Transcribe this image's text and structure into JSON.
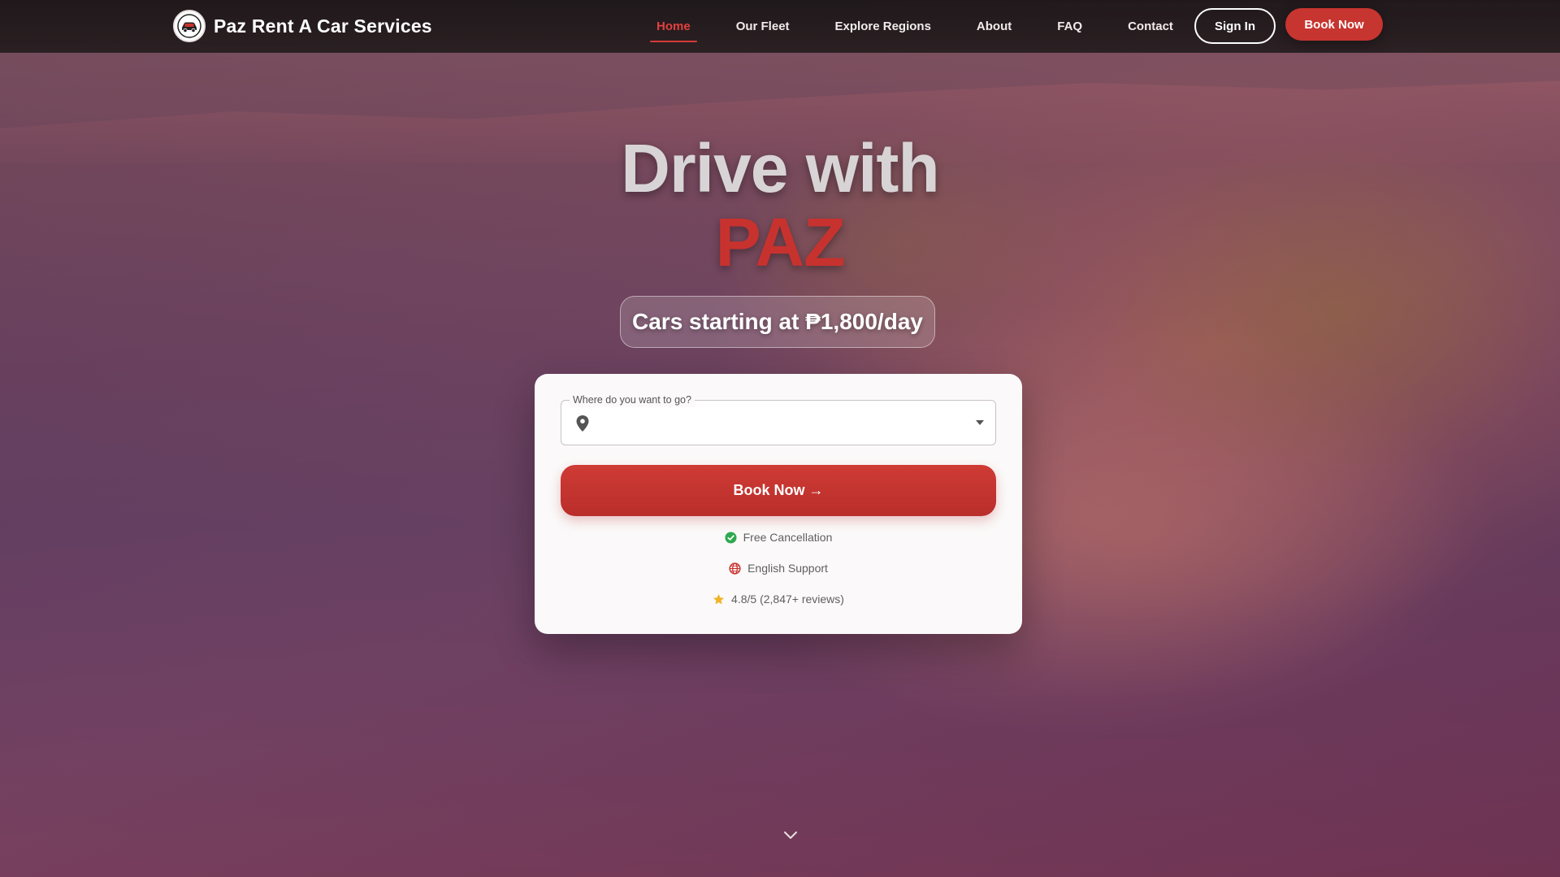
{
  "brand": {
    "name": "Paz Rent A Car Services",
    "logo_icon": "car-logo-icon"
  },
  "nav": {
    "items": [
      {
        "label": "Home",
        "active": true
      },
      {
        "label": "Our Fleet",
        "active": false
      },
      {
        "label": "Explore Regions",
        "active": false
      },
      {
        "label": "About",
        "active": false
      },
      {
        "label": "FAQ",
        "active": false
      },
      {
        "label": "Contact",
        "active": false
      }
    ],
    "sign_in_label": "Sign In",
    "book_now_label": "Book Now"
  },
  "hero": {
    "headline": "Drive with",
    "headline_brand": "PAZ",
    "price_text": "Cars starting at ₱1,800/day"
  },
  "booking": {
    "destination_label": "Where do you want to go?",
    "destination_value": "",
    "destination_icon": "map-pin-icon",
    "book_button_label": "Book Now →",
    "features": [
      {
        "icon": "check-circle-icon",
        "text": "Free Cancellation"
      },
      {
        "icon": "globe-icon",
        "text": "English Support"
      },
      {
        "icon": "star-icon",
        "text": "4.8/5 (2,847+ reviews)"
      }
    ]
  },
  "colors": {
    "accent": "#c8322e",
    "accent_active_nav": "#e0413d",
    "navbar_bg": "#1c1618",
    "card_bg": "#fbf9f9",
    "check_green": "#2fa84f",
    "star_gold": "#f0b429"
  },
  "scroll_indicator_icon": "chevron-down-icon"
}
